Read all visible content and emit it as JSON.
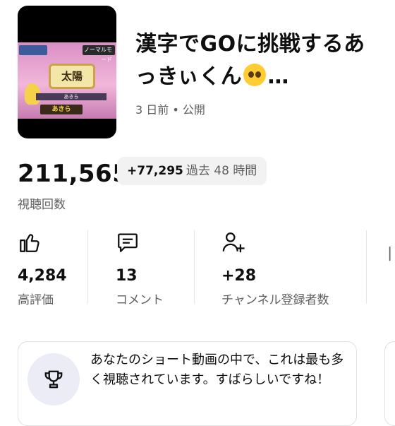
{
  "video": {
    "thumbnail": {
      "hud_mode": "ノーマルモード",
      "kanji": "太陽",
      "answer": "あきら",
      "player_name": "あきら"
    },
    "title_text": "漢字でGOに挑戦するあっきぃくん",
    "title_ellipsis": "…",
    "emoji_icon": "pleading-face-emoji",
    "age": "3 日前",
    "meta_sep": " • ",
    "visibility": "公開"
  },
  "views": {
    "count": "211,565",
    "delta": "+77,295",
    "period": "過去 48 時間",
    "label": "視聴回数"
  },
  "stats": [
    {
      "icon": "thumbs-up-icon",
      "value": "4,284",
      "label": "高評価"
    },
    {
      "icon": "comment-icon",
      "value": "13",
      "label": "コメント"
    },
    {
      "icon": "person-add-icon",
      "value": "+28",
      "label": "チャンネル登録者数"
    }
  ],
  "insight_card": {
    "icon": "trophy-icon",
    "text": "あなたのショート動画の中で、これは最も多く視聴されています。すばらしいですね！"
  },
  "colors": {
    "text_primary": "#0f0f0f",
    "text_secondary": "#606060",
    "pill_bg": "#f2f2f2",
    "card_icon_bg": "#ececf7"
  }
}
